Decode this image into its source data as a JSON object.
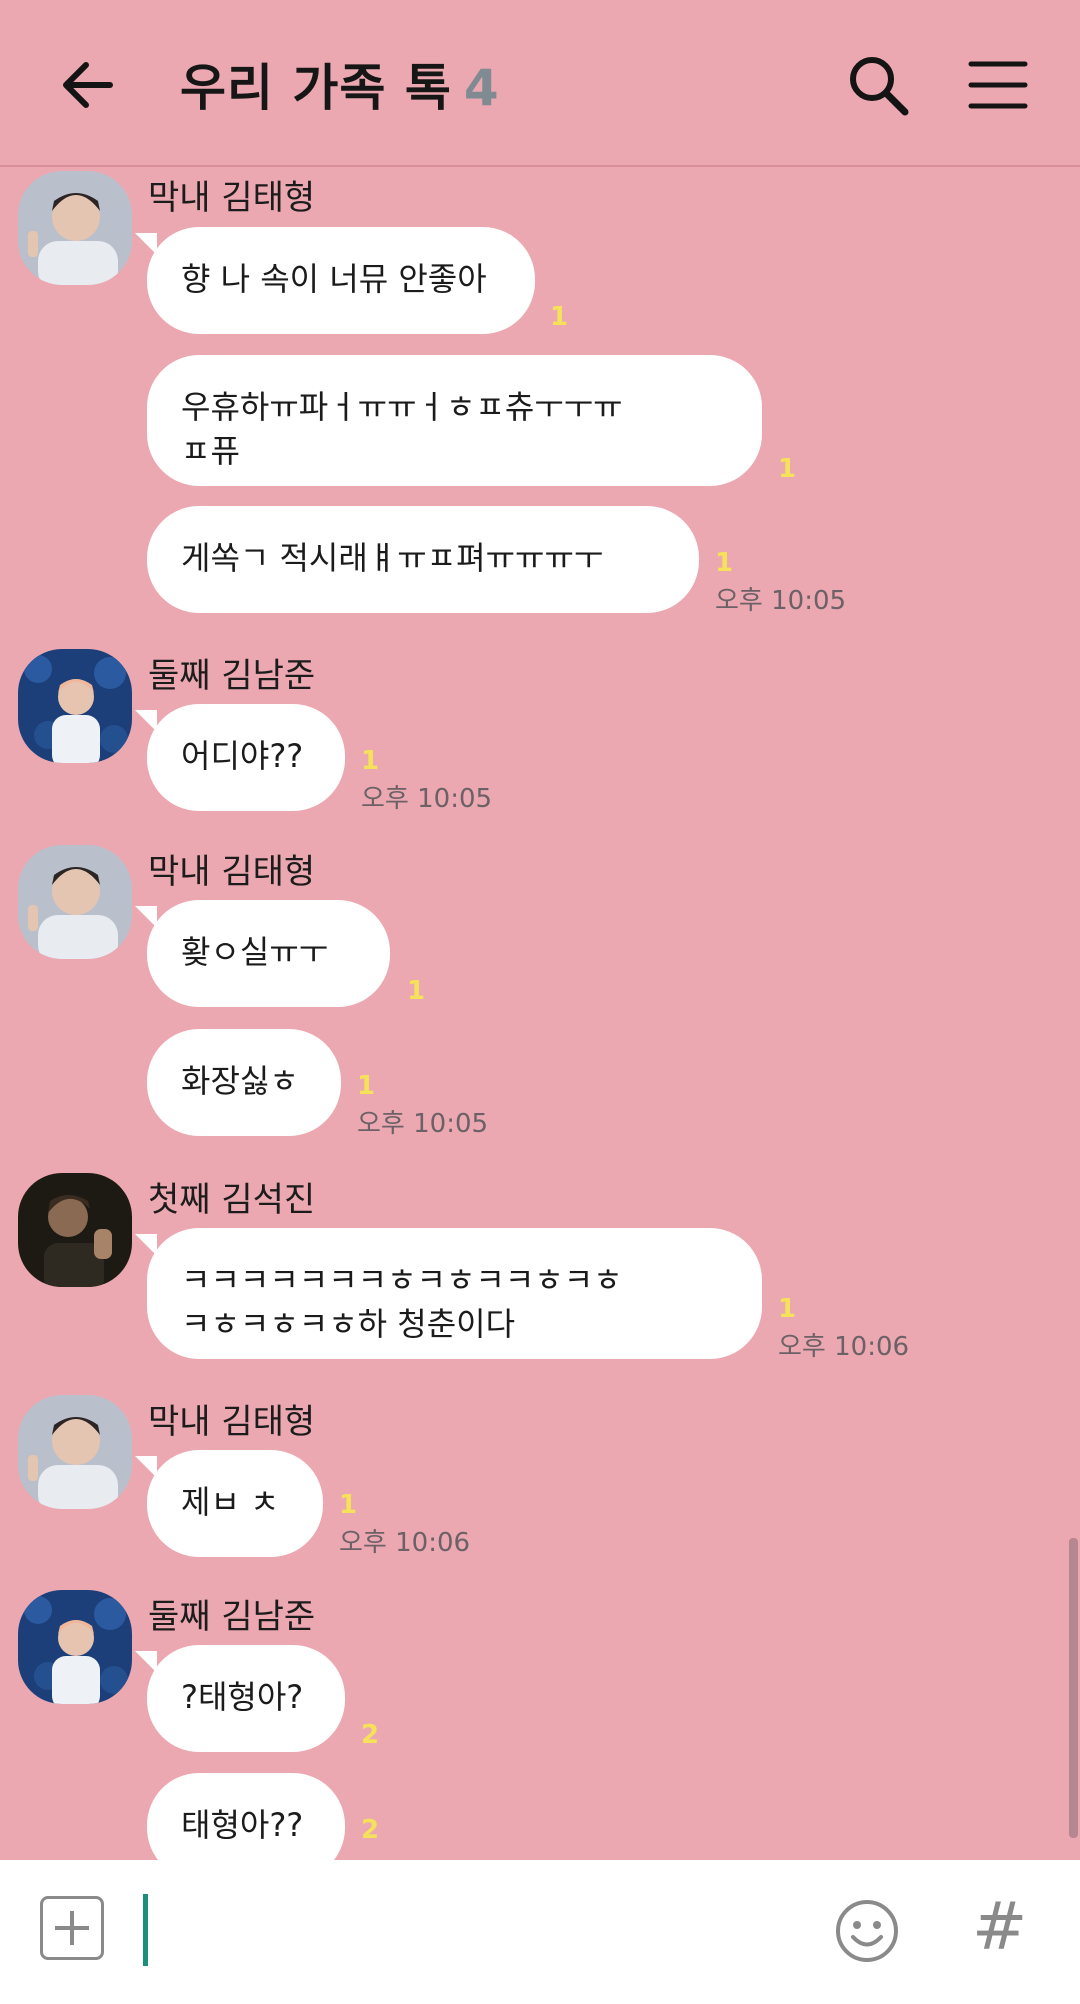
{
  "header": {
    "title": "우리 가족 톡",
    "member_count": "4"
  },
  "messages": [
    {
      "sender": "막내 김태형",
      "avatar": "avatar-taehyung",
      "bubbles": [
        {
          "text": "향 나 속이 너뮤 안좋아",
          "unread": "1",
          "time": ""
        },
        {
          "text": "우휴하ㅠ파ㅓㅠㅠㅓㅎㅍ츄ㅜㅜㅠ\nㅍ퓨",
          "unread": "1",
          "time": ""
        },
        {
          "text": "게쏙ㄱ 적시래ㅒㅠㅍ펴ㅠㅠㅠㅜ",
          "unread": "1",
          "time": "오후 10:05"
        }
      ]
    },
    {
      "sender": "둘째 김남준",
      "avatar": "avatar-namjoon",
      "bubbles": [
        {
          "text": "어디야??",
          "unread": "1",
          "time": "오후 10:05"
        }
      ]
    },
    {
      "sender": "막내 김태형",
      "avatar": "avatar-taehyung",
      "bubbles": [
        {
          "text": "홪ㅇ실ㅠㅜ",
          "unread": "1",
          "time": ""
        },
        {
          "text": "화장싫ㅎ",
          "unread": "1",
          "time": "오후 10:05"
        }
      ]
    },
    {
      "sender": "첫째 김석진",
      "avatar": "avatar-seokjin",
      "bubbles": [
        {
          "text": "ㅋㅋㅋㅋㅋㅋㅋㅎㅋㅎㅋㅋㅎㅋㅎ\nㅋㅎㅋㅎㅋㅎ하 청춘이다",
          "unread": "1",
          "time": "오후 10:06"
        }
      ]
    },
    {
      "sender": "막내 김태형",
      "avatar": "avatar-taehyung",
      "bubbles": [
        {
          "text": "제ㅂ ㅊ",
          "unread": "1",
          "time": "오후 10:06"
        }
      ]
    },
    {
      "sender": "둘째 김남준",
      "avatar": "avatar-namjoon",
      "bubbles": [
        {
          "text": "?태형아?",
          "unread": "2",
          "time": ""
        },
        {
          "text": "태형아??",
          "unread": "2",
          "time": ""
        }
      ]
    }
  ],
  "input": {
    "placeholder": ""
  },
  "icons": {
    "back": "arrow-left-icon",
    "search": "search-icon",
    "menu": "hamburger-menu-icon",
    "attach": "plus-square-icon",
    "emoji": "smiley-icon",
    "hashtag": "hash-icon"
  },
  "colors": {
    "background": "#eba8b0",
    "bubble": "#ffffff",
    "unread": "#f5e15a",
    "caret": "#1a8f7a"
  }
}
